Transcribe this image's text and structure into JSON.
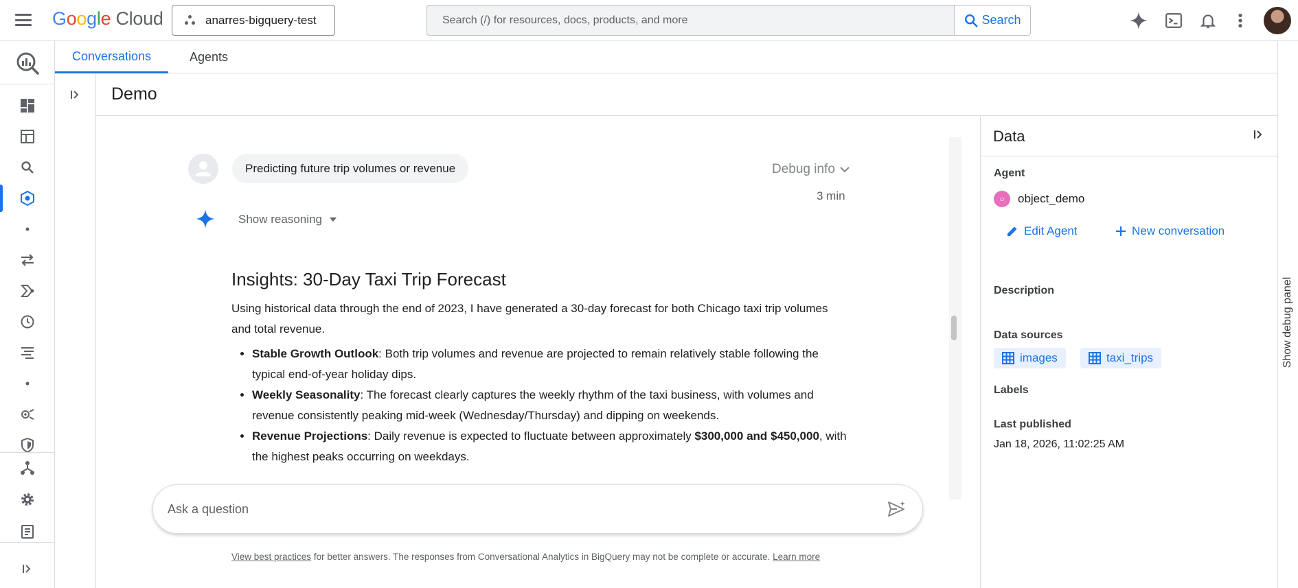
{
  "brand": {
    "logo_google": "Google",
    "logo_cloud": "Cloud"
  },
  "project": {
    "name": "anarres-bigquery-test"
  },
  "search": {
    "placeholder": "Search (/) for resources, docs, products, and more",
    "button_label": "Search"
  },
  "tabs": [
    {
      "label": "Conversations",
      "active": true
    },
    {
      "label": "Agents",
      "active": false
    }
  ],
  "page": {
    "title": "Demo"
  },
  "conversation": {
    "user_message": "Predicting future trip volumes or revenue",
    "debug_label": "Debug info",
    "time_ago": "3 min",
    "show_reasoning": "Show reasoning",
    "insights_title": "Insights: 30-Day Taxi Trip Forecast",
    "insights_intro": "Using historical data through the end of 2023, I have generated a 30-day forecast for both Chicago taxi trip volumes and total revenue.",
    "bullets": [
      {
        "bold": "Stable Growth Outlook",
        "text": ": Both trip volumes and revenue are projected to remain relatively stable following the typical end-of-year holiday dips."
      },
      {
        "bold": "Weekly Seasonality",
        "text": ": The forecast clearly captures the weekly rhythm of the taxi business, with volumes and revenue consistently peaking mid-week (Wednesday/Thursday) and dipping on weekends."
      },
      {
        "bold": "Revenue Projections",
        "text": ": Daily revenue is expected to fluctuate between approximately ",
        "bold2": "$300,000 and $450,000",
        "text2": ", with the highest peaks occurring on weekdays."
      }
    ]
  },
  "composer": {
    "placeholder": "Ask a question"
  },
  "footer": {
    "link1": "View best practices",
    "middle": " for better answers. The responses from Conversational Analytics in BigQuery may not be complete or accurate. ",
    "link2": "Learn more"
  },
  "data_panel": {
    "title": "Data",
    "agent_label": "Agent",
    "agent_name": "object_demo",
    "edit_agent": "Edit Agent",
    "new_conversation": "New conversation",
    "description_label": "Description",
    "data_sources_label": "Data sources",
    "data_sources": [
      "images",
      "taxi_trips"
    ],
    "labels_label": "Labels",
    "last_published_label": "Last published",
    "last_published_value": "Jan 18, 2026, 11:02:25 AM"
  },
  "debug_panel": {
    "label": "Show debug panel"
  },
  "colors": {
    "accent": "#1a73e8",
    "agent_dot": "#e76fbd",
    "border": "#dadce0"
  },
  "icons": [
    "menu-icon",
    "project-icon",
    "search-icon",
    "gemini-icon",
    "terminal-icon",
    "bell-icon",
    "more-vert-icon",
    "bigquery-logo-icon",
    "dashboard-icon",
    "explorer-icon",
    "search-nav-icon",
    "agent-nav-icon",
    "transfer-icon",
    "pipeline-icon",
    "history-icon",
    "tune-icon",
    "observe-icon",
    "shield-icon",
    "graph-icon",
    "settings-icon",
    "notes-icon",
    "expand-icon",
    "send-icon",
    "pencil-icon",
    "plus-icon",
    "table-icon"
  ]
}
